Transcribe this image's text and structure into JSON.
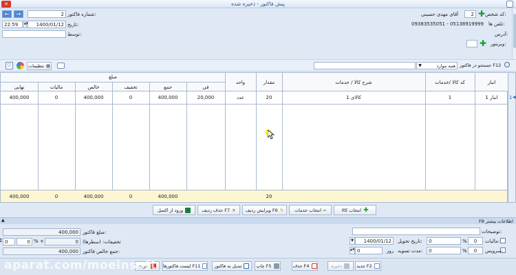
{
  "window": {
    "title": "پیش فاکتور - ذخیره شده"
  },
  "header": {
    "invoice_number_label": "شماره فاکتور:",
    "invoice_number": "2",
    "date_label": "تاریخ:",
    "date_value": "1400/01/12",
    "time_value": "22:59",
    "by_label": "توسط:",
    "by_value": "",
    "person_code_label": "کد شخص:",
    "person_code": "2",
    "person_name": "آقای مهدی حسینی",
    "phone_label": "تلفن ها:",
    "phone_value": "09383535051 - 05138919999",
    "address_label": "آدرس:",
    "visitor_label": "ویزیتور:",
    "visitor_value": ""
  },
  "toolbar": {
    "settings_label": "تنظیمات",
    "search_label": "جستجو در فاکتور F12",
    "search_value": "همه موارد",
    "search_text": ""
  },
  "table": {
    "amount_group": "مبلغ",
    "headers": [
      "انبار",
      "کد کالا /خدمات",
      "شرح کالا / خدمات",
      "مقدار",
      "واحد",
      "فی",
      "جمع",
      "تخفیف",
      "خالص",
      "مالیات",
      "نهایی"
    ],
    "rows": [
      {
        "num": "1",
        "warehouse": "انبار 1",
        "code": "1",
        "desc": "کالای 1",
        "qty": "20",
        "unit": "عدد",
        "unit_price": "20,000",
        "total": "400,000",
        "discount": "0",
        "net": "400,000",
        "tax": "0",
        "final": "400,000"
      }
    ],
    "footer": {
      "qty": "20",
      "total": "400,000",
      "discount": "0",
      "net": "400,000",
      "tax": "0",
      "final": "400,000"
    }
  },
  "row_actions": {
    "select_goods": "انتخاب کالا",
    "select_services": "انتخاب خدمات",
    "edit_row": "ویرایش ردیف F6",
    "delete_row": "حذف ردیف F7",
    "excel_import": "ورود از اکسل"
  },
  "more_info": {
    "title": "F8 اطلاعات بیشتر",
    "description_label": "توضیحات:",
    "description_value": "",
    "tax_label": "مالیات:",
    "tax_value": "0",
    "tax_amount": "0",
    "delivery_date_label": "تاریخ تحویل:",
    "delivery_date": "1400/01/12",
    "service_label": "سرویس:",
    "service_value": "0",
    "service_amount": "0",
    "settlement_label": "مدت تسویه:",
    "settlement_value": "0",
    "settlement_unit": "روز",
    "invoice_amount_label": "مبلغ فاکتور:",
    "invoice_amount": "400,000",
    "discounts_label": "تخفیفات: (سطرها)",
    "discounts_value": "0",
    "extra_discount_amount": "0",
    "extra_discount_percent": "0",
    "net_total_label": "جمع خالص فاکتور:",
    "net_total": "400,000"
  },
  "bottom_bar": {
    "new": "جدید F2",
    "save": "ذخیره",
    "delete": "حذف F4",
    "print": "چاپ F5",
    "convert": "تبدیل به فاکتور",
    "list": "لیست فاکتورها F11",
    "exit": "خروج"
  },
  "watermark": "aparat.com/moeinsoft",
  "percent_sign": "%",
  "sigma": "Σ",
  "colors": {
    "accent_blue": "#3f76c9",
    "footer_yellow": "#fdf6d3",
    "background": "#dfe9f6"
  }
}
